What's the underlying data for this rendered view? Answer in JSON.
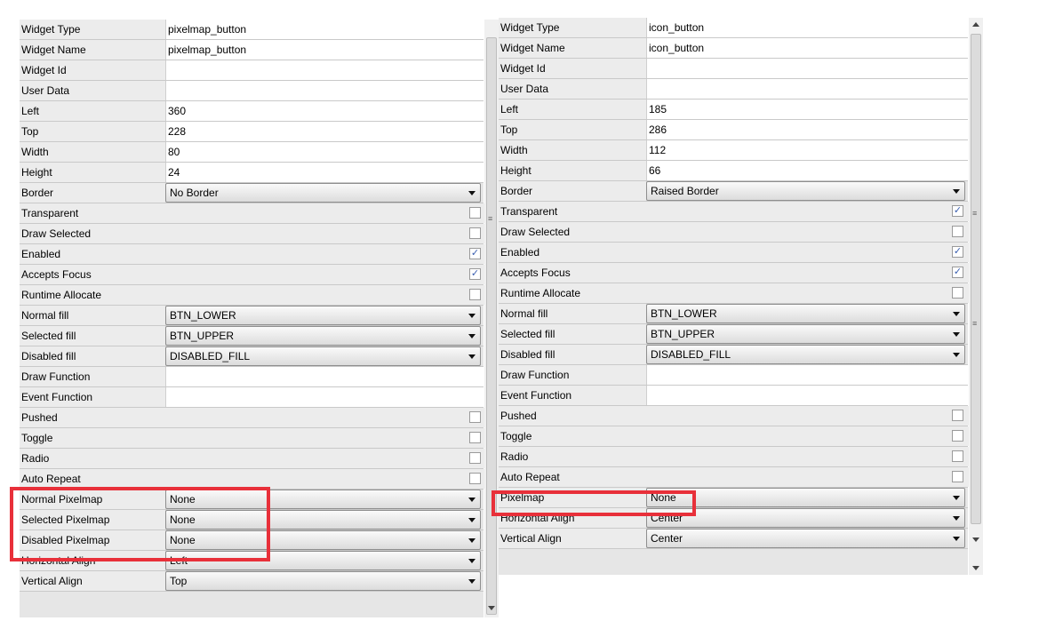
{
  "left_panel": {
    "widget_type": {
      "label": "Widget Type",
      "value": "pixelmap_button"
    },
    "widget_name": {
      "label": "Widget Name",
      "value": "pixelmap_button"
    },
    "widget_id": {
      "label": "Widget Id",
      "value": ""
    },
    "user_data": {
      "label": "User Data",
      "value": ""
    },
    "left": {
      "label": "Left",
      "value": "360"
    },
    "top": {
      "label": "Top",
      "value": "228"
    },
    "width": {
      "label": "Width",
      "value": "80"
    },
    "height": {
      "label": "Height",
      "value": "24"
    },
    "border": {
      "label": "Border",
      "value": "No Border"
    },
    "transparent": {
      "label": "Transparent",
      "checked": false
    },
    "draw_selected": {
      "label": "Draw Selected",
      "checked": false
    },
    "enabled": {
      "label": "Enabled",
      "checked": true
    },
    "accepts_focus": {
      "label": "Accepts Focus",
      "checked": true
    },
    "runtime_allocate": {
      "label": "Runtime Allocate",
      "checked": false
    },
    "normal_fill": {
      "label": "Normal fill",
      "value": "BTN_LOWER"
    },
    "selected_fill": {
      "label": "Selected fill",
      "value": "BTN_UPPER"
    },
    "disabled_fill": {
      "label": "Disabled fill",
      "value": "DISABLED_FILL"
    },
    "draw_function": {
      "label": "Draw Function",
      "value": ""
    },
    "event_function": {
      "label": "Event Function",
      "value": ""
    },
    "pushed": {
      "label": "Pushed",
      "checked": false
    },
    "toggle": {
      "label": "Toggle",
      "checked": false
    },
    "radio": {
      "label": "Radio",
      "checked": false
    },
    "auto_repeat": {
      "label": "Auto Repeat",
      "checked": false
    },
    "normal_pixelmap": {
      "label": "Normal Pixelmap",
      "value": "None"
    },
    "selected_pixelmap": {
      "label": "Selected Pixelmap",
      "value": "None"
    },
    "disabled_pixelmap": {
      "label": "Disabled Pixelmap",
      "value": "None"
    },
    "horizontal_align": {
      "label": "Horizontal Align",
      "value": "Left"
    },
    "vertical_align": {
      "label": "Vertical Align",
      "value": "Top"
    }
  },
  "right_panel": {
    "widget_type": {
      "label": "Widget Type",
      "value": "icon_button"
    },
    "widget_name": {
      "label": "Widget Name",
      "value": "icon_button"
    },
    "widget_id": {
      "label": "Widget Id",
      "value": ""
    },
    "user_data": {
      "label": "User Data",
      "value": ""
    },
    "left": {
      "label": "Left",
      "value": "185"
    },
    "top": {
      "label": "Top",
      "value": "286"
    },
    "width": {
      "label": "Width",
      "value": "112"
    },
    "height": {
      "label": "Height",
      "value": "66"
    },
    "border": {
      "label": "Border",
      "value": "Raised Border"
    },
    "transparent": {
      "label": "Transparent",
      "checked": true
    },
    "draw_selected": {
      "label": "Draw Selected",
      "checked": false
    },
    "enabled": {
      "label": "Enabled",
      "checked": true
    },
    "accepts_focus": {
      "label": "Accepts Focus",
      "checked": true
    },
    "runtime_allocate": {
      "label": "Runtime Allocate",
      "checked": false
    },
    "normal_fill": {
      "label": "Normal fill",
      "value": "BTN_LOWER"
    },
    "selected_fill": {
      "label": "Selected fill",
      "value": "BTN_UPPER"
    },
    "disabled_fill": {
      "label": "Disabled fill",
      "value": "DISABLED_FILL"
    },
    "draw_function": {
      "label": "Draw Function",
      "value": ""
    },
    "event_function": {
      "label": "Event Function",
      "value": ""
    },
    "pushed": {
      "label": "Pushed",
      "checked": false
    },
    "toggle": {
      "label": "Toggle",
      "checked": false
    },
    "radio": {
      "label": "Radio",
      "checked": false
    },
    "auto_repeat": {
      "label": "Auto Repeat",
      "checked": false
    },
    "pixelmap": {
      "label": "Pixelmap",
      "value": "None"
    },
    "horizontal_align": {
      "label": "Horizontal Align",
      "value": "Center"
    },
    "vertical_align": {
      "label": "Vertical Align",
      "value": "Center"
    }
  },
  "icons": {
    "checkbox_checked": "check-icon",
    "dropdown_arrow": "chevron-down-icon",
    "scroll_up": "arrow-up-icon",
    "scroll_down": "arrow-down-icon",
    "splitter_grip": "grip-icon"
  },
  "colors": {
    "highlight": "#e8303a",
    "check": "#3a5fb0",
    "panel_bg": "#e6e6e6"
  }
}
